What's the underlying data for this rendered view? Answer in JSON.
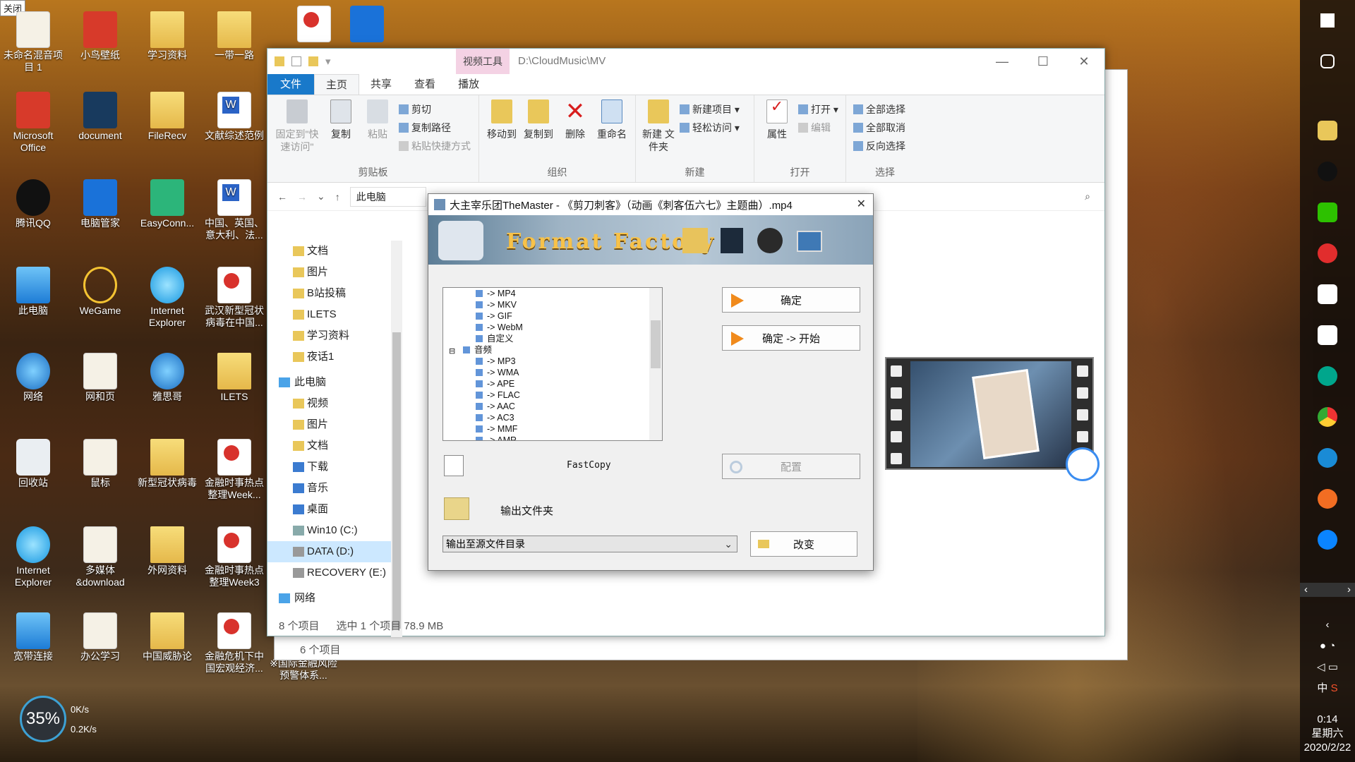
{
  "tooltip": "关闭",
  "desktop": {
    "col1": [
      "未命名混音项目 1",
      "Microsoft Office",
      "腾讯QQ",
      "此电脑",
      "网络",
      "回收站",
      "Internet Explorer",
      "宽带连接"
    ],
    "col2": [
      "小鸟壁纸",
      "document",
      "电脑管家",
      "WeGame",
      "网和页",
      "鼠标",
      "多媒体 &download",
      "办公学习"
    ],
    "col3": [
      "学习资料",
      "FileRecv",
      "EasyConn...",
      "Internet Explorer",
      "雅思哥",
      "新型冠状病毒",
      "外网资料",
      "中国威胁论"
    ],
    "col4": [
      "一带一路",
      "文献综述范例",
      "中国、英国、意大利、法...",
      "武汉新型冠状病毒在中国...",
      "ILETS",
      "金融时事热点整理Week...",
      "金融时事热点整理Week3",
      "金融危机下中国宏观经济..."
    ],
    "extra_label": "※国际金融风险预警体系..."
  },
  "explorer": {
    "video_tools": "视频工具",
    "path": "D:\\CloudMusic\\MV",
    "tabs": [
      "文件",
      "主页",
      "共享",
      "查看",
      "播放"
    ],
    "ribbon": {
      "pin": "固定到\"快速访问\"",
      "copy": "复制",
      "paste": "粘贴",
      "cut": "剪切",
      "copy_path": "复制路径",
      "paste_shortcut": "粘贴快捷方式",
      "clipboard": "剪贴板",
      "move_to": "移动到",
      "copy_to": "复制到",
      "delete": "删除",
      "rename": "重命名",
      "organize": "组织",
      "new_folder": "新建 文件夹",
      "new_item": "新建项目 ▾",
      "easy_access": "轻松访问 ▾",
      "new": "新建",
      "properties": "属性",
      "open": "打开 ▾",
      "edit": "编辑",
      "open_group": "打开",
      "select_all": "全部选择",
      "select_none": "全部取消",
      "invert": "反向选择",
      "select": "选择"
    },
    "breadcrumb": "此电脑",
    "nav": [
      "文档",
      "图片",
      "B站投稿",
      "ILETS",
      "学习资料",
      "夜话1",
      "此电脑",
      "视频",
      "图片",
      "文档",
      "下载",
      "音乐",
      "桌面",
      "Win10 (C:)",
      "DATA (D:)",
      "RECOVERY (E:)",
      "网络"
    ],
    "status_count": "8 个项目",
    "status_selected": "选中 1 个项目  78.9 MB",
    "behind_status": "6 个项目"
  },
  "ff": {
    "title": "大主宰乐团TheMaster - 《剪刀刺客》（动画《刺客伍六七》主题曲）.mp4",
    "logo": "Format Factory",
    "tree": [
      "-> MP4",
      "-> MKV",
      "-> GIF",
      "-> WebM",
      "自定义",
      "音频",
      "-> MP3",
      "-> WMA",
      "-> APE",
      "-> FLAC",
      "-> AAC",
      "-> AC3",
      "-> MMF",
      "-> AMR"
    ],
    "ok": "确定",
    "ok_start": "确定 -> 开始",
    "fastcopy": "FastCopy",
    "config": "配置",
    "output_folder": "输出文件夹",
    "output_option": "输出至源文件目录",
    "change": "改变"
  },
  "tray": {
    "time": "0:14",
    "weekday": "星期六",
    "date": "2020/2/22",
    "ime": "中"
  },
  "net": {
    "cpu": "35%",
    "up": "0K/s",
    "down": "0.2K/s"
  }
}
